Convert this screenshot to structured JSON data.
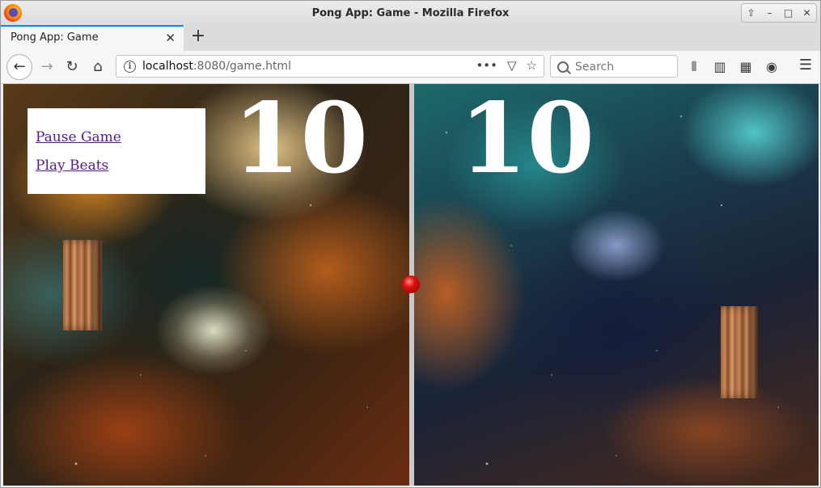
{
  "window": {
    "title": "Pong App: Game - Mozilla Firefox",
    "controls": [
      "up-arrow",
      "minimize",
      "maximize",
      "close"
    ]
  },
  "tabs": [
    {
      "label": "Pong App: Game",
      "active": true
    }
  ],
  "toolbar": {
    "url_host": "localhost",
    "url_path": ":8080/game.html",
    "search_placeholder": "Search",
    "icons": [
      "back-icon",
      "forward-icon",
      "reload-icon",
      "home-icon",
      "info-icon",
      "page-actions-icon",
      "pocket-icon",
      "bookmark-star-icon",
      "library-icon",
      "sidebar-icon",
      "container-icon",
      "account-icon",
      "menu-icon"
    ]
  },
  "game": {
    "menu": {
      "pause_label": "Pause Game",
      "beats_label": "Play Beats"
    },
    "score_left": "10",
    "score_right": "10",
    "colors": {
      "divider": "#c9c9c9",
      "ball": "#e01010",
      "link": "#551a8b",
      "score": "#ffffff"
    }
  }
}
